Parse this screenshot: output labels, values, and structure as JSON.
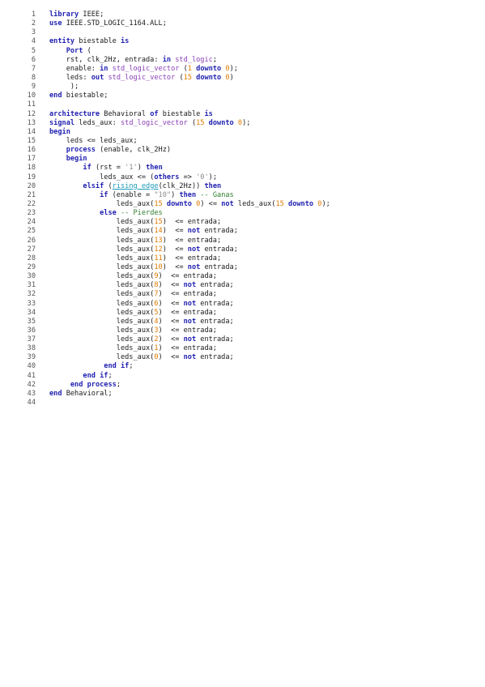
{
  "code": {
    "lines": [
      {
        "n": "1",
        "tokens": [
          {
            "t": "library",
            "c": "kw"
          },
          {
            "t": " IEEE;"
          }
        ]
      },
      {
        "n": "2",
        "tokens": [
          {
            "t": "use",
            "c": "kw"
          },
          {
            "t": " IEEE.STD_LOGIC_1164.ALL;"
          }
        ]
      },
      {
        "n": "3",
        "tokens": []
      },
      {
        "n": "4",
        "tokens": [
          {
            "t": "entity",
            "c": "kw"
          },
          {
            "t": " biestable "
          },
          {
            "t": "is",
            "c": "kw"
          }
        ]
      },
      {
        "n": "5",
        "tokens": [
          {
            "t": "    "
          },
          {
            "t": "Port",
            "c": "kw"
          },
          {
            "t": " ("
          }
        ]
      },
      {
        "n": "6",
        "tokens": [
          {
            "t": "    rst, clk_2Hz, entrada: "
          },
          {
            "t": "in",
            "c": "kw"
          },
          {
            "t": " "
          },
          {
            "t": "std_logic",
            "c": "ty"
          },
          {
            "t": ";"
          }
        ]
      },
      {
        "n": "7",
        "tokens": [
          {
            "t": "    enable: "
          },
          {
            "t": "in",
            "c": "kw"
          },
          {
            "t": " "
          },
          {
            "t": "std_logic_vector",
            "c": "ty"
          },
          {
            "t": " ("
          },
          {
            "t": "1",
            "c": "num"
          },
          {
            "t": " "
          },
          {
            "t": "downto",
            "c": "kw"
          },
          {
            "t": " "
          },
          {
            "t": "0",
            "c": "num"
          },
          {
            "t": ");"
          }
        ]
      },
      {
        "n": "8",
        "tokens": [
          {
            "t": "    leds: "
          },
          {
            "t": "out",
            "c": "kw"
          },
          {
            "t": " "
          },
          {
            "t": "std_logic_vector",
            "c": "ty"
          },
          {
            "t": " ("
          },
          {
            "t": "15",
            "c": "num"
          },
          {
            "t": " "
          },
          {
            "t": "downto",
            "c": "kw"
          },
          {
            "t": " "
          },
          {
            "t": "0",
            "c": "num"
          },
          {
            "t": ")"
          }
        ]
      },
      {
        "n": "9",
        "tokens": [
          {
            "t": "     );"
          }
        ]
      },
      {
        "n": "10",
        "tokens": [
          {
            "t": "end",
            "c": "kw"
          },
          {
            "t": " biestable;"
          }
        ]
      },
      {
        "n": "11",
        "tokens": []
      },
      {
        "n": "12",
        "tokens": [
          {
            "t": "architecture",
            "c": "kw"
          },
          {
            "t": " Behavioral "
          },
          {
            "t": "of",
            "c": "kw"
          },
          {
            "t": " biestable "
          },
          {
            "t": "is",
            "c": "kw"
          }
        ]
      },
      {
        "n": "13",
        "tokens": [
          {
            "t": "signal",
            "c": "kw"
          },
          {
            "t": " leds_aux: "
          },
          {
            "t": "std_logic_vector",
            "c": "ty"
          },
          {
            "t": " ("
          },
          {
            "t": "15",
            "c": "num"
          },
          {
            "t": " "
          },
          {
            "t": "downto",
            "c": "kw"
          },
          {
            "t": " "
          },
          {
            "t": "0",
            "c": "num"
          },
          {
            "t": ");"
          }
        ]
      },
      {
        "n": "14",
        "tokens": [
          {
            "t": "begin",
            "c": "kw"
          }
        ]
      },
      {
        "n": "15",
        "tokens": [
          {
            "t": "    leds <= leds_aux;"
          }
        ]
      },
      {
        "n": "16",
        "tokens": [
          {
            "t": "    "
          },
          {
            "t": "process",
            "c": "kw"
          },
          {
            "t": " (enable, clk_2Hz)"
          }
        ]
      },
      {
        "n": "17",
        "tokens": [
          {
            "t": "    "
          },
          {
            "t": "begin",
            "c": "kw"
          }
        ]
      },
      {
        "n": "18",
        "tokens": [
          {
            "t": "        "
          },
          {
            "t": "if",
            "c": "kw"
          },
          {
            "t": " (rst = "
          },
          {
            "t": "'1'",
            "c": "str"
          },
          {
            "t": ") "
          },
          {
            "t": "then",
            "c": "kw"
          }
        ]
      },
      {
        "n": "19",
        "tokens": [
          {
            "t": "            leds_aux <= ("
          },
          {
            "t": "others",
            "c": "kw"
          },
          {
            "t": " => "
          },
          {
            "t": "'0'",
            "c": "str"
          },
          {
            "t": ");"
          }
        ]
      },
      {
        "n": "20",
        "tokens": [
          {
            "t": "        "
          },
          {
            "t": "elsif",
            "c": "kw"
          },
          {
            "t": " ("
          },
          {
            "t": "rising_edge",
            "c": "fn"
          },
          {
            "t": "(clk_2Hz)) "
          },
          {
            "t": "then",
            "c": "kw"
          }
        ]
      },
      {
        "n": "21",
        "tokens": [
          {
            "t": "            "
          },
          {
            "t": "if",
            "c": "kw"
          },
          {
            "t": " (enable = "
          },
          {
            "t": "\"10\"",
            "c": "str"
          },
          {
            "t": ") "
          },
          {
            "t": "then",
            "c": "kw"
          },
          {
            "t": " "
          },
          {
            "t": "-- Ganas",
            "c": "cm"
          }
        ]
      },
      {
        "n": "22",
        "tokens": [
          {
            "t": "                leds_aux("
          },
          {
            "t": "15",
            "c": "num"
          },
          {
            "t": " "
          },
          {
            "t": "downto",
            "c": "kw"
          },
          {
            "t": " "
          },
          {
            "t": "0",
            "c": "num"
          },
          {
            "t": ") <= "
          },
          {
            "t": "not",
            "c": "kw"
          },
          {
            "t": " leds_aux("
          },
          {
            "t": "15",
            "c": "num"
          },
          {
            "t": " "
          },
          {
            "t": "downto",
            "c": "kw"
          },
          {
            "t": " "
          },
          {
            "t": "0",
            "c": "num"
          },
          {
            "t": ");"
          }
        ]
      },
      {
        "n": "23",
        "tokens": [
          {
            "t": "            "
          },
          {
            "t": "else",
            "c": "kw"
          },
          {
            "t": " "
          },
          {
            "t": "-- Pierdes",
            "c": "cm"
          }
        ]
      },
      {
        "n": "24",
        "tokens": [
          {
            "t": "                leds_aux("
          },
          {
            "t": "15",
            "c": "num"
          },
          {
            "t": ")  <= entrada;"
          }
        ]
      },
      {
        "n": "25",
        "tokens": [
          {
            "t": "                leds_aux("
          },
          {
            "t": "14",
            "c": "num"
          },
          {
            "t": ")  <= "
          },
          {
            "t": "not",
            "c": "kw"
          },
          {
            "t": " entrada;"
          }
        ]
      },
      {
        "n": "26",
        "tokens": [
          {
            "t": "                leds_aux("
          },
          {
            "t": "13",
            "c": "num"
          },
          {
            "t": ")  <= entrada;"
          }
        ]
      },
      {
        "n": "27",
        "tokens": [
          {
            "t": "                leds_aux("
          },
          {
            "t": "12",
            "c": "num"
          },
          {
            "t": ")  <= "
          },
          {
            "t": "not",
            "c": "kw"
          },
          {
            "t": " entrada;"
          }
        ]
      },
      {
        "n": "28",
        "tokens": [
          {
            "t": "                leds_aux("
          },
          {
            "t": "11",
            "c": "num"
          },
          {
            "t": ")  <= entrada;"
          }
        ]
      },
      {
        "n": "29",
        "tokens": [
          {
            "t": "                leds_aux("
          },
          {
            "t": "10",
            "c": "num"
          },
          {
            "t": ")  <= "
          },
          {
            "t": "not",
            "c": "kw"
          },
          {
            "t": " entrada;"
          }
        ]
      },
      {
        "n": "30",
        "tokens": [
          {
            "t": "                leds_aux("
          },
          {
            "t": "9",
            "c": "num"
          },
          {
            "t": ")  <= entrada;"
          }
        ]
      },
      {
        "n": "31",
        "tokens": [
          {
            "t": "                leds_aux("
          },
          {
            "t": "8",
            "c": "num"
          },
          {
            "t": ")  <= "
          },
          {
            "t": "not",
            "c": "kw"
          },
          {
            "t": " entrada;"
          }
        ]
      },
      {
        "n": "32",
        "tokens": [
          {
            "t": "                leds_aux("
          },
          {
            "t": "7",
            "c": "num"
          },
          {
            "t": ")  <= entrada;"
          }
        ]
      },
      {
        "n": "33",
        "tokens": [
          {
            "t": "                leds_aux("
          },
          {
            "t": "6",
            "c": "num"
          },
          {
            "t": ")  <= "
          },
          {
            "t": "not",
            "c": "kw"
          },
          {
            "t": " entrada;"
          }
        ]
      },
      {
        "n": "34",
        "tokens": [
          {
            "t": "                leds_aux("
          },
          {
            "t": "5",
            "c": "num"
          },
          {
            "t": ")  <= entrada;"
          }
        ]
      },
      {
        "n": "35",
        "tokens": [
          {
            "t": "                leds_aux("
          },
          {
            "t": "4",
            "c": "num"
          },
          {
            "t": ")  <= "
          },
          {
            "t": "not",
            "c": "kw"
          },
          {
            "t": " entrada;"
          }
        ]
      },
      {
        "n": "36",
        "tokens": [
          {
            "t": "                leds_aux("
          },
          {
            "t": "3",
            "c": "num"
          },
          {
            "t": ")  <= entrada;"
          }
        ]
      },
      {
        "n": "37",
        "tokens": [
          {
            "t": "                leds_aux("
          },
          {
            "t": "2",
            "c": "num"
          },
          {
            "t": ")  <= "
          },
          {
            "t": "not",
            "c": "kw"
          },
          {
            "t": " entrada;"
          }
        ]
      },
      {
        "n": "38",
        "tokens": [
          {
            "t": "                leds_aux("
          },
          {
            "t": "1",
            "c": "num"
          },
          {
            "t": ")  <= entrada;"
          }
        ]
      },
      {
        "n": "39",
        "tokens": [
          {
            "t": "                leds_aux("
          },
          {
            "t": "0",
            "c": "num"
          },
          {
            "t": ")  <= "
          },
          {
            "t": "not",
            "c": "kw"
          },
          {
            "t": " entrada;"
          }
        ]
      },
      {
        "n": "40",
        "tokens": [
          {
            "t": "             "
          },
          {
            "t": "end",
            "c": "kw"
          },
          {
            "t": " "
          },
          {
            "t": "if",
            "c": "kw"
          },
          {
            "t": ";"
          }
        ]
      },
      {
        "n": "41",
        "tokens": [
          {
            "t": "        "
          },
          {
            "t": "end",
            "c": "kw"
          },
          {
            "t": " "
          },
          {
            "t": "if",
            "c": "kw"
          },
          {
            "t": ";"
          }
        ]
      },
      {
        "n": "42",
        "tokens": [
          {
            "t": "     "
          },
          {
            "t": "end",
            "c": "kw"
          },
          {
            "t": " "
          },
          {
            "t": "process",
            "c": "kw"
          },
          {
            "t": ";"
          }
        ]
      },
      {
        "n": "43",
        "tokens": [
          {
            "t": "end",
            "c": "kw"
          },
          {
            "t": " Behavioral;"
          }
        ]
      },
      {
        "n": "44",
        "tokens": []
      }
    ]
  }
}
